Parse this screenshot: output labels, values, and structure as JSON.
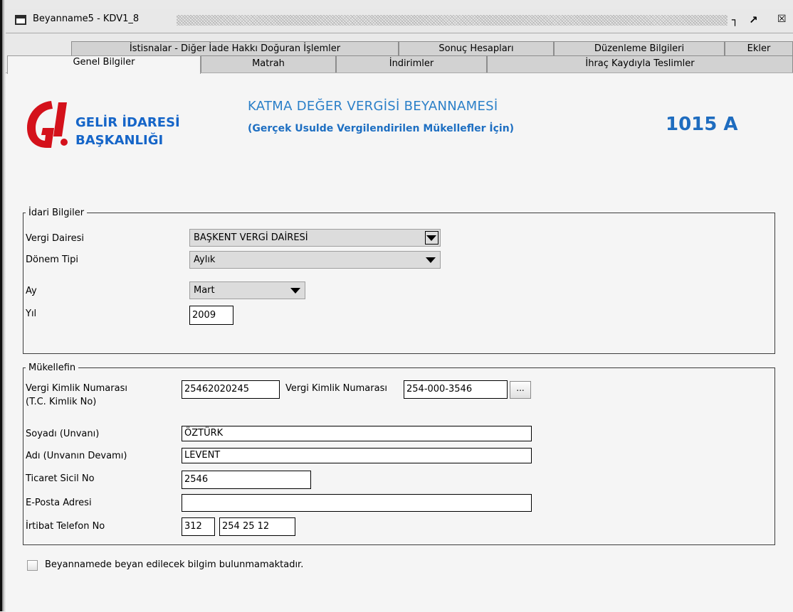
{
  "window": {
    "title": "Beyanname5 - KDV1_8",
    "minimize_icon": "restore-down-icon",
    "maximize_icon": "maximize-icon",
    "close_icon": "close-icon"
  },
  "tabs_row1": [
    "İstisnalar - Diğer İade Hakkı Doğuran İşlemler",
    "Sonuç Hesapları",
    "Düzenleme Bilgileri",
    "Ekler"
  ],
  "tabs_row2": [
    "Genel Bilgiler",
    "Matrah",
    "İndirimler",
    "İhraç Kaydıyla Teslimler"
  ],
  "active_tab": "Genel Bilgiler",
  "header": {
    "org_line1": "GELİR İDARESİ",
    "org_line2": "BAŞKANLIĞI",
    "form_title": "KATMA DEĞER VERGİSİ BEYANNAMESİ",
    "form_subtitle": "(Gerçek Usulde Vergilendirilen Mükellefler İçin)",
    "form_code": "1015 A",
    "brand_color": "#1565c8",
    "logo_color": "#d4111b"
  },
  "idari": {
    "legend": "İdari Bilgiler",
    "vergi_dairesi_label": "Vergi Dairesi",
    "vergi_dairesi_value": "BAŞKENT VERGİ DAİRESİ",
    "donem_tipi_label": "Dönem Tipi",
    "donem_tipi_value": "Aylık",
    "ay_label": "Ay",
    "ay_value": "Mart",
    "yil_label": "Yıl",
    "yil_value": "2009"
  },
  "mukellef": {
    "legend": "Mükellefin",
    "tc_label_line1": "Vergi Kimlik Numarası",
    "tc_label_line2": "(T.C. Kimlik No)",
    "tc_value": "25462020245",
    "vkn_label": "Vergi Kimlik Numarası",
    "vkn_value": "254-000-3546",
    "browse_label": "...",
    "soyadi_label": "Soyadı (Unvanı)",
    "soyadi_value": "ÖZTÜRK",
    "adi_label": "Adı (Unvanın Devamı)",
    "adi_value": "LEVENT",
    "ticaret_label": "Ticaret Sicil No",
    "ticaret_value": "2546",
    "eposta_label": "E-Posta Adresi",
    "eposta_value": "",
    "telefon_label": "İrtibat Telefon No",
    "telefon_alan": "312",
    "telefon_no": "254 25 12"
  },
  "checkbox": {
    "label": "Beyannamede beyan edilecek bilgim bulunmamaktadır.",
    "checked": false
  }
}
